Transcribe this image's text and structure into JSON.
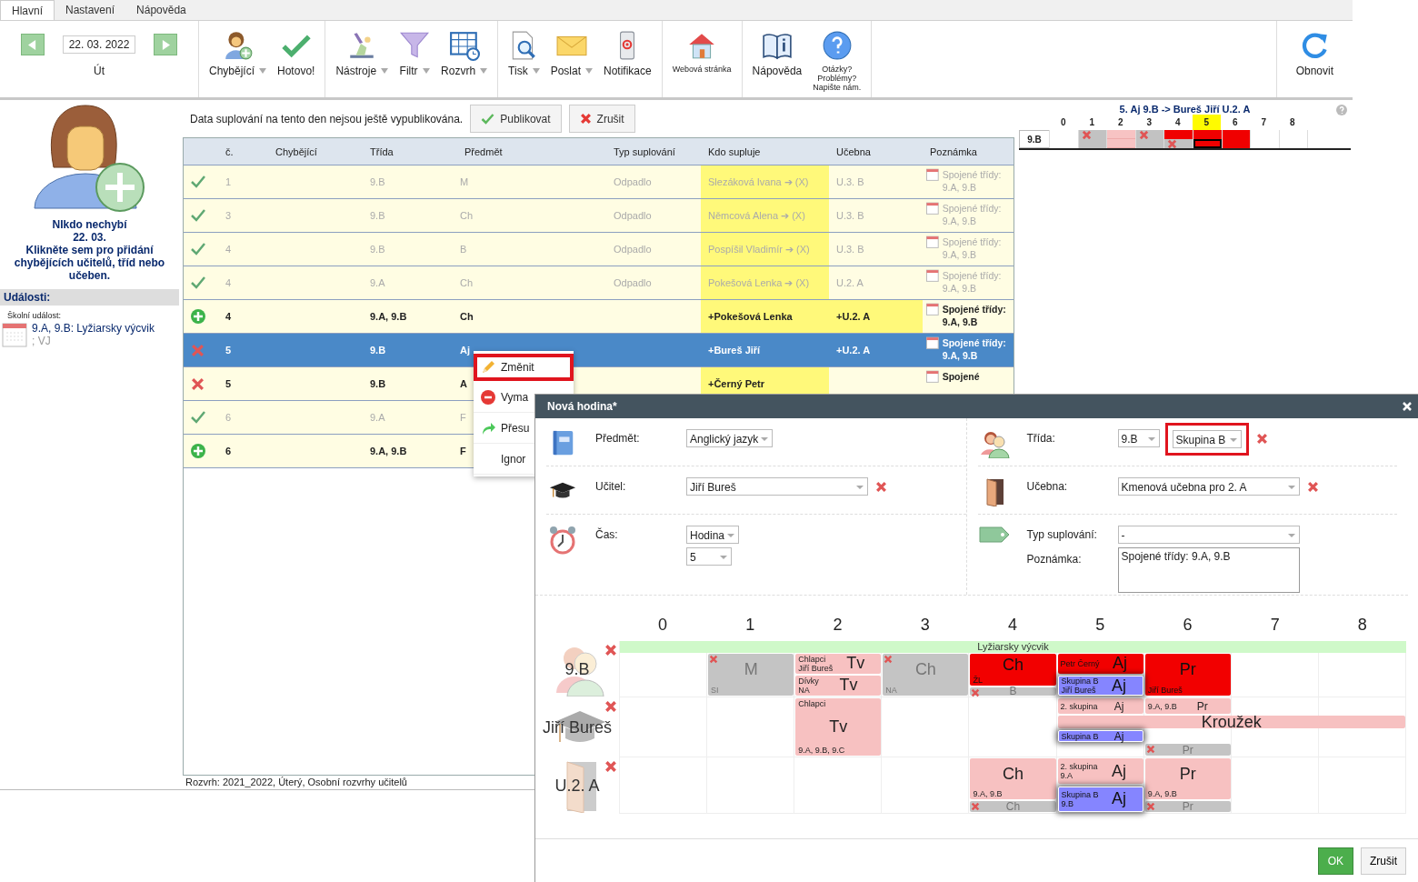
{
  "tabs": [
    {
      "label": "Hlavní",
      "selected": true
    },
    {
      "label": "Nastavení",
      "selected": false
    },
    {
      "label": "Nápověda",
      "selected": false
    }
  ],
  "toolbar": {
    "date": "22. 03. 2022",
    "day": "Út",
    "groups": [
      [
        {
          "kind": "absent",
          "label": "Chybějící",
          "dropdown": true
        },
        {
          "kind": "done",
          "label": "Hotovo!",
          "dropdown": false
        }
      ],
      [
        {
          "kind": "tools",
          "label": "Nástroje",
          "dropdown": true
        },
        {
          "kind": "filter",
          "label": "Filtr",
          "dropdown": true
        },
        {
          "kind": "timetable",
          "label": "Rozvrh",
          "dropdown": true
        }
      ],
      [
        {
          "kind": "print",
          "label": "Tisk",
          "dropdown": true
        },
        {
          "kind": "send",
          "label": "Poslat",
          "dropdown": true
        },
        {
          "kind": "notify",
          "label": "Notifikace",
          "dropdown": false
        }
      ],
      [
        {
          "kind": "web",
          "label": "Webová stránka",
          "dropdown": false
        }
      ],
      [
        {
          "kind": "help",
          "label": "Nápověda",
          "dropdown": false
        },
        {
          "kind": "question",
          "lines": [
            "Otázky?",
            "Problémy?",
            "Napište nám."
          ],
          "dropdown": false
        }
      ]
    ],
    "refresh": {
      "kind": "refresh",
      "label": "Obnovit"
    }
  },
  "sidebar": {
    "lines": [
      "NIkdo nechybí",
      "22. 03.",
      "Klikněte sem pro přidání chybějících učitelů, tříd nebo učeben."
    ],
    "events_heading": "Události:",
    "event_type": "Školní událost:",
    "event": "9.A, 9.B: Lyžiarsky výcvik",
    "event_note": "; VJ"
  },
  "notice": {
    "text": "Data suplování na tento den nejsou ještě vypublikována.",
    "publish": "Publikovat",
    "cancel": "Zrušit"
  },
  "table": {
    "columns": [
      "č.",
      "Chybějící",
      "Třída",
      "Předmět",
      "Typ suplování",
      "Kdo supluje",
      "Učebna",
      "Poznámka"
    ],
    "rows": [
      {
        "kind": "done",
        "selected": false,
        "number": "1",
        "class": "9.B",
        "subject": "M",
        "type": "Odpadlo",
        "substitute": "Slezáková Ivana ➔ (X)",
        "sub_highlighted": true,
        "room": "U.3. B",
        "room_highlighted": false,
        "note": "Spojené třídy: 9.A, 9.B"
      },
      {
        "kind": "done",
        "selected": false,
        "number": "3",
        "class": "9.B",
        "subject": "Ch",
        "type": "Odpadlo",
        "substitute": "Němcová Alena ➔ (X)",
        "sub_highlighted": true,
        "room": "U.3. B",
        "room_highlighted": false,
        "note": "Spojené třídy: 9.A, 9.B"
      },
      {
        "kind": "done",
        "selected": false,
        "number": "4",
        "class": "9.B",
        "subject": "B",
        "type": "Odpadlo",
        "substitute": "Pospíšil Vladimír ➔ (X)",
        "sub_highlighted": true,
        "room": "U.3. B",
        "room_highlighted": false,
        "note": "Spojené třídy: 9.A, 9.B"
      },
      {
        "kind": "done",
        "selected": false,
        "number": "4",
        "class": "9.A",
        "subject": "Ch",
        "type": "Odpadlo",
        "substitute": "Pokešová Lenka ➔ (X)",
        "sub_highlighted": true,
        "room": "U.2. A",
        "room_highlighted": false,
        "note": "Spojené třídy: 9.A, 9.B"
      },
      {
        "kind": "added",
        "selected": false,
        "number": "4",
        "class": "9.A, 9.B",
        "subject": "Ch",
        "substitute": "+Pokešová Lenka",
        "sub_highlighted": true,
        "room": "+U.2. A",
        "room_highlighted": true,
        "note": "Spojené třídy: 9.A, 9.B"
      },
      {
        "kind": "removed",
        "selected": true,
        "number": "5",
        "class": "9.B",
        "subject": "Aj",
        "substitute": "+Bureš Jiří",
        "sub_highlighted": false,
        "room": "+U.2. A",
        "room_highlighted": false,
        "note": "Spojené třídy: 9.A, 9.B"
      },
      {
        "kind": "removed",
        "selected": false,
        "number": "5",
        "class": "9.B",
        "subject": "A",
        "substitute": "+Černý Petr",
        "sub_highlighted": true,
        "room_highlighted": false,
        "note": "Spojené"
      },
      {
        "kind": "done",
        "selected": false,
        "number": "6",
        "class": "9.A",
        "subject": "F"
      },
      {
        "kind": "added",
        "selected": false,
        "number": "6",
        "class": "9.A, 9.B",
        "subject": "F"
      }
    ]
  },
  "footer": "Rozvrh: 2021_2022, Úterý, Osobní rozvrhy učitelů",
  "context_menu": [
    {
      "kind": "edit",
      "label": "Změnit",
      "highlighted": true
    },
    {
      "kind": "delete",
      "label": "Vyma",
      "highlighted": false
    },
    {
      "kind": "move",
      "label": "Přesu",
      "highlighted": false
    },
    {
      "kind": "ignore",
      "label": "Ignor",
      "highlighted": false
    }
  ],
  "mini": {
    "title": "5. Aj 9.B -> Bureš Jiří U.2. A",
    "periods": [
      {
        "label": "0",
        "selected": false
      },
      {
        "label": "1",
        "selected": false
      },
      {
        "label": "2",
        "selected": false
      },
      {
        "label": "3",
        "selected": false
      },
      {
        "label": "4",
        "selected": false
      },
      {
        "label": "5",
        "selected": true
      },
      {
        "label": "6",
        "selected": false
      },
      {
        "label": "7",
        "selected": false
      },
      {
        "label": "8",
        "selected": false
      }
    ],
    "row": "9.B",
    "cells": [
      {
        "halves": [
          {
            "kind": "empty",
            "removed": false,
            "selected": false
          },
          {
            "kind": "empty",
            "removed": false,
            "selected": false
          }
        ]
      },
      {
        "halves": [
          {
            "kind": "gray",
            "removed": true,
            "selected": false
          },
          {
            "kind": "gray",
            "removed": false,
            "selected": false
          }
        ]
      },
      {
        "halves": [
          {
            "kind": "pink",
            "removed": false,
            "selected": false
          },
          {
            "kind": "pink",
            "removed": false,
            "selected": false
          }
        ]
      },
      {
        "halves": [
          {
            "kind": "gray",
            "removed": true,
            "selected": false
          },
          {
            "kind": "gray",
            "removed": false,
            "selected": false
          }
        ]
      },
      {
        "halves": [
          {
            "kind": "red",
            "removed": false,
            "selected": false
          },
          {
            "kind": "gray",
            "removed": true,
            "selected": false
          }
        ]
      },
      {
        "halves": [
          {
            "kind": "red",
            "removed": false,
            "selected": false
          },
          {
            "kind": "red",
            "removed": false,
            "selected": true
          }
        ]
      },
      {
        "halves": [
          {
            "kind": "red",
            "removed": false,
            "selected": false
          },
          {
            "kind": "red",
            "removed": false,
            "selected": false
          }
        ]
      },
      {
        "halves": [
          {
            "kind": "empty",
            "removed": false,
            "selected": false
          },
          {
            "kind": "empty",
            "removed": false,
            "selected": false
          }
        ]
      },
      {
        "halves": [
          {
            "kind": "empty",
            "removed": false,
            "selected": false
          },
          {
            "kind": "empty",
            "removed": false,
            "selected": false
          }
        ]
      }
    ]
  },
  "dialog": {
    "title": "Nová hodina*",
    "subject": {
      "label": "Předmět:",
      "value": "Anglický jazyk"
    },
    "teacher": {
      "label": "Učitel:",
      "value": "Jiří Bureš"
    },
    "time": {
      "label": "Čas:",
      "unit": "Hodina",
      "period": "5"
    },
    "class": {
      "label": "Třída:",
      "value": "9.B",
      "group": "Skupina B",
      "group_highlighted": true
    },
    "room": {
      "label": "Učebna:",
      "value": "Kmenová učebna pro 2. A"
    },
    "type": {
      "label": "Typ suplování:",
      "value": "-"
    },
    "note": {
      "label": "Poznámka:",
      "value": "Spojené třídy: 9.A, 9.B"
    },
    "ok": "OK",
    "cancel": "Zrušit",
    "timetable": {
      "periods": [
        "0",
        "1",
        "2",
        "3",
        "4",
        "5",
        "6",
        "7",
        "8"
      ],
      "rows": [
        {
          "kind": "class",
          "label": "9.B",
          "event": "Lyžiarsky výcvik",
          "cells": [
            {},
            {
              "lessons": [
                {
                  "kind": "gray",
                  "subject": "M",
                  "bottom": "SI",
                  "removed": true,
                  "selected": false
                }
              ]
            },
            {
              "lessons": [
                {
                  "kind": "pink",
                  "subject": "Tv",
                  "top": [
                    "Chlapci",
                    "Jiří Bureš"
                  ],
                  "removed": false,
                  "selected": false
                },
                {
                  "kind": "pink",
                  "subject": "Tv",
                  "top": [
                    "Dívky",
                    "NA"
                  ],
                  "removed": false,
                  "selected": false
                }
              ]
            },
            {
              "lessons": [
                {
                  "kind": "gray",
                  "subject": "Ch",
                  "bottom": "NA",
                  "removed": true,
                  "selected": false
                }
              ]
            },
            {
              "lessons": [
                {
                  "kind": "red",
                  "subject": "Ch",
                  "bottom": "ŽL",
                  "removed": false,
                  "selected": false
                },
                {
                  "kind": "cancelled",
                  "subject": "B",
                  "removed": true,
                  "selected": false
                }
              ]
            },
            {
              "lessons": [
                {
                  "kind": "red",
                  "subject": "Aj",
                  "top": [
                    "Petr Černý"
                  ],
                  "removed": false,
                  "selected": false
                },
                {
                  "kind": "blue",
                  "subject": "Aj",
                  "top": [
                    "Skupina B",
                    "Jiří Bureš"
                  ],
                  "removed": false,
                  "selected": true
                }
              ]
            },
            {
              "lessons": [
                {
                  "kind": "red",
                  "subject": "Pr",
                  "bottom": "Jiří Bureš",
                  "removed": false,
                  "selected": false
                }
              ]
            },
            {},
            {}
          ]
        },
        {
          "kind": "teacher",
          "label": "Jiří Bureš",
          "cells": [
            {},
            {},
            {
              "lessons": [
                {
                  "kind": "pink",
                  "subject": "Tv",
                  "top": [
                    "Chlapci"
                  ],
                  "bottom": "9.A, 9.B, 9.C",
                  "removed": false,
                  "selected": false
                }
              ]
            },
            {},
            {},
            {
              "club": {
                "subject": "Kroužek"
              },
              "lessons": [
                {
                  "kind": "pink",
                  "subject": "Aj",
                  "top": [
                    "2. skupina"
                  ],
                  "removed": false,
                  "selected": false
                },
                {
                  "kind": "blue",
                  "subject": "Aj",
                  "top": [
                    "Skupina B"
                  ],
                  "removed": false,
                  "selected": true
                }
              ]
            },
            {
              "lessons": [
                {
                  "kind": "pink",
                  "subject": "Pr",
                  "top": [
                    "9.A, 9.B"
                  ],
                  "removed": false,
                  "selected": false
                },
                {
                  "kind": "cancelled",
                  "subject": "Pr",
                  "removed": true,
                  "selected": false
                }
              ]
            },
            {},
            {}
          ]
        },
        {
          "kind": "room",
          "label": "U.2. A",
          "cells": [
            {},
            {},
            {},
            {},
            {
              "lessons": [
                {
                  "kind": "pink",
                  "subject": "Ch",
                  "bottom": "9.A, 9.B",
                  "removed": false,
                  "selected": false
                },
                {
                  "kind": "cancelled",
                  "subject": "Ch",
                  "removed": true,
                  "selected": false
                }
              ]
            },
            {
              "lessons": [
                {
                  "kind": "pink",
                  "subject": "Aj",
                  "top": [
                    "2. skupina",
                    "9.A"
                  ],
                  "removed": false,
                  "selected": false
                },
                {
                  "kind": "blue",
                  "subject": "Aj",
                  "top": [
                    "Skupina B",
                    "9.B"
                  ],
                  "removed": false,
                  "selected": true
                }
              ]
            },
            {
              "lessons": [
                {
                  "kind": "pink",
                  "subject": "Pr",
                  "bottom": "9.A, 9.B",
                  "removed": false,
                  "selected": false
                },
                {
                  "kind": "cancelled",
                  "subject": "Pr",
                  "removed": true,
                  "selected": false
                }
              ]
            },
            {},
            {}
          ]
        }
      ]
    }
  }
}
